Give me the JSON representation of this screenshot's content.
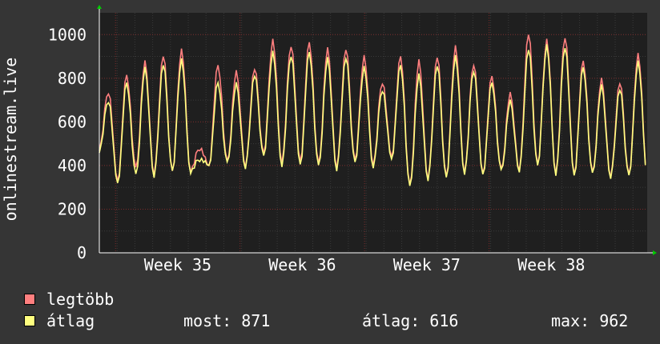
{
  "chart_data": {
    "type": "line",
    "ylabel": "onlinestream.live",
    "ylim": [
      0,
      1100
    ],
    "yticks": [
      0,
      200,
      400,
      600,
      800,
      1000
    ],
    "xlim": [
      33.37,
      37.77
    ],
    "xticks": [
      {
        "label": "Week 35",
        "value": 34
      },
      {
        "label": "Week 36",
        "value": 35
      },
      {
        "label": "Week 37",
        "value": 36
      },
      {
        "label": "Week 38",
        "value": 37
      }
    ],
    "grid": true,
    "series": [
      {
        "name": "legtöbb",
        "color": "#ff7f7f",
        "peaks": [
          740,
          815,
          870,
          905,
          930,
          480,
          860,
          825,
          845,
          975,
          955,
          965,
          930,
          935,
          900,
          785,
          900,
          875,
          900,
          945,
          870,
          810,
          725,
          1005,
          975,
          995,
          880,
          790,
          780,
          910
        ],
        "troughs": [
          330,
          380,
          360,
          370,
          380,
          400,
          410,
          395,
          450,
          420,
          420,
          400,
          390,
          420,
          410,
          440,
          300,
          340,
          345,
          375,
          365,
          375,
          380,
          400,
          370,
          360,
          360,
          350,
          355,
          370
        ]
      },
      {
        "name": "átlag",
        "color": "#ffff7f",
        "peaks": [
          700,
          780,
          840,
          865,
          885,
          430,
          780,
          770,
          815,
          920,
          910,
          920,
          885,
          895,
          850,
          750,
          860,
          810,
          860,
          900,
          840,
          780,
          690,
          935,
          950,
          950,
          850,
          760,
          750,
          875
        ],
        "troughs": [
          320,
          350,
          350,
          370,
          375,
          400,
          405,
          390,
          440,
          405,
          405,
          390,
          380,
          410,
          400,
          430,
          295,
          335,
          340,
          370,
          360,
          370,
          375,
          395,
          365,
          355,
          355,
          345,
          350,
          365
        ]
      }
    ]
  },
  "legend": [
    {
      "label": "legtöbb",
      "color": "#ff7f7f"
    },
    {
      "label": "átlag",
      "color": "#ffff7f"
    }
  ],
  "stats": {
    "most": "most: 871",
    "atlag": "átlag: 616",
    "max": "max: 962"
  }
}
